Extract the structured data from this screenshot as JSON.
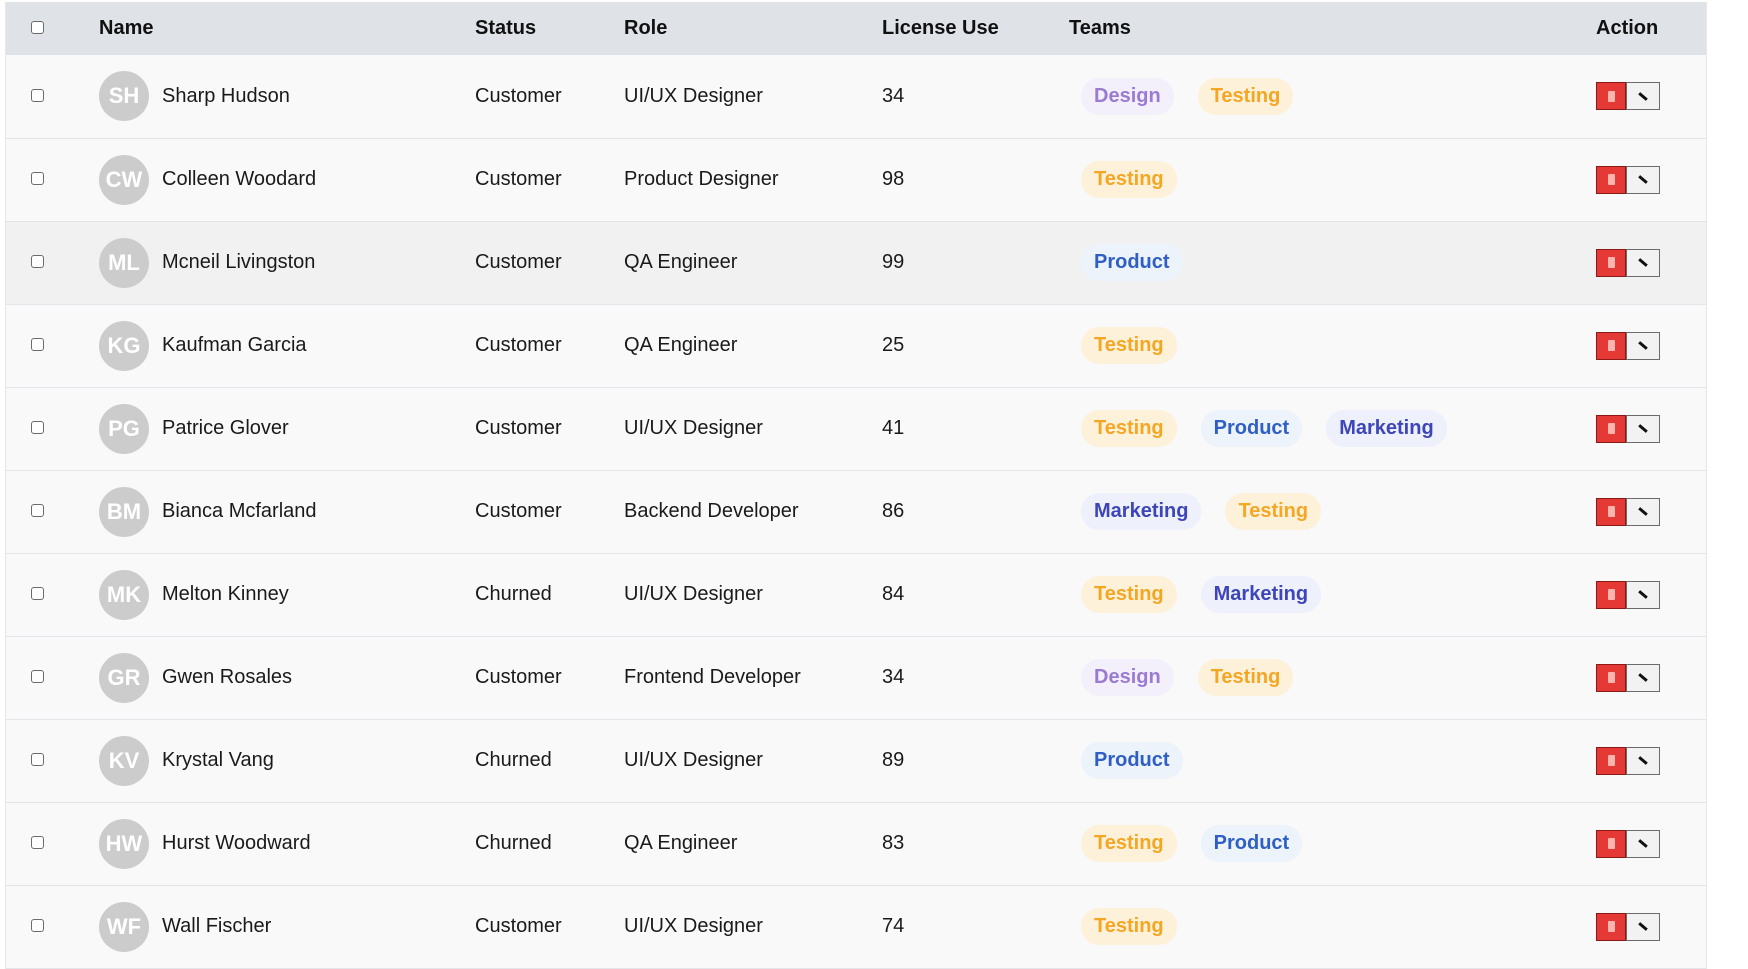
{
  "header": {
    "name": "Name",
    "status": "Status",
    "role": "Role",
    "license": "License Use",
    "teams": "Teams",
    "action": "Action"
  },
  "team_styles": {
    "Design": {
      "bg": "#f3f0fb",
      "fg": "#9b7ad1"
    },
    "Testing": {
      "bg": "#fdf1da",
      "fg": "#f5a623"
    },
    "Product": {
      "bg": "#edf3fb",
      "fg": "#2f5fc4"
    },
    "Marketing": {
      "bg": "#eef0fb",
      "fg": "#3d46b8"
    }
  },
  "icons": {
    "delete": "trash-icon",
    "edit": "pencil-icon"
  },
  "rows": [
    {
      "initials": "SH",
      "name": "Sharp Hudson",
      "status": "Customer",
      "role": "UI/UX Designer",
      "license": "34",
      "teams": [
        "Design",
        "Testing"
      ]
    },
    {
      "initials": "CW",
      "name": "Colleen Woodard",
      "status": "Customer",
      "role": "Product Designer",
      "license": "98",
      "teams": [
        "Testing"
      ]
    },
    {
      "initials": "ML",
      "name": "Mcneil Livingston",
      "status": "Customer",
      "role": "QA Engineer",
      "license": "99",
      "teams": [
        "Product"
      ]
    },
    {
      "initials": "KG",
      "name": "Kaufman Garcia",
      "status": "Customer",
      "role": "QA Engineer",
      "license": "25",
      "teams": [
        "Testing"
      ]
    },
    {
      "initials": "PG",
      "name": "Patrice Glover",
      "status": "Customer",
      "role": "UI/UX Designer",
      "license": "41",
      "teams": [
        "Testing",
        "Product",
        "Marketing"
      ]
    },
    {
      "initials": "BM",
      "name": "Bianca Mcfarland",
      "status": "Customer",
      "role": "Backend Developer",
      "license": "86",
      "teams": [
        "Marketing",
        "Testing"
      ]
    },
    {
      "initials": "MK",
      "name": "Melton Kinney",
      "status": "Churned",
      "role": "UI/UX Designer",
      "license": "84",
      "teams": [
        "Testing",
        "Marketing"
      ]
    },
    {
      "initials": "GR",
      "name": "Gwen Rosales",
      "status": "Customer",
      "role": "Frontend Developer",
      "license": "34",
      "teams": [
        "Design",
        "Testing"
      ]
    },
    {
      "initials": "KV",
      "name": "Krystal Vang",
      "status": "Churned",
      "role": "UI/UX Designer",
      "license": "89",
      "teams": [
        "Product"
      ]
    },
    {
      "initials": "HW",
      "name": "Hurst Woodward",
      "status": "Churned",
      "role": "QA Engineer",
      "license": "83",
      "teams": [
        "Testing",
        "Product"
      ]
    },
    {
      "initials": "WF",
      "name": "Wall Fischer",
      "status": "Customer",
      "role": "UI/UX Designer",
      "license": "74",
      "teams": [
        "Testing"
      ]
    }
  ]
}
